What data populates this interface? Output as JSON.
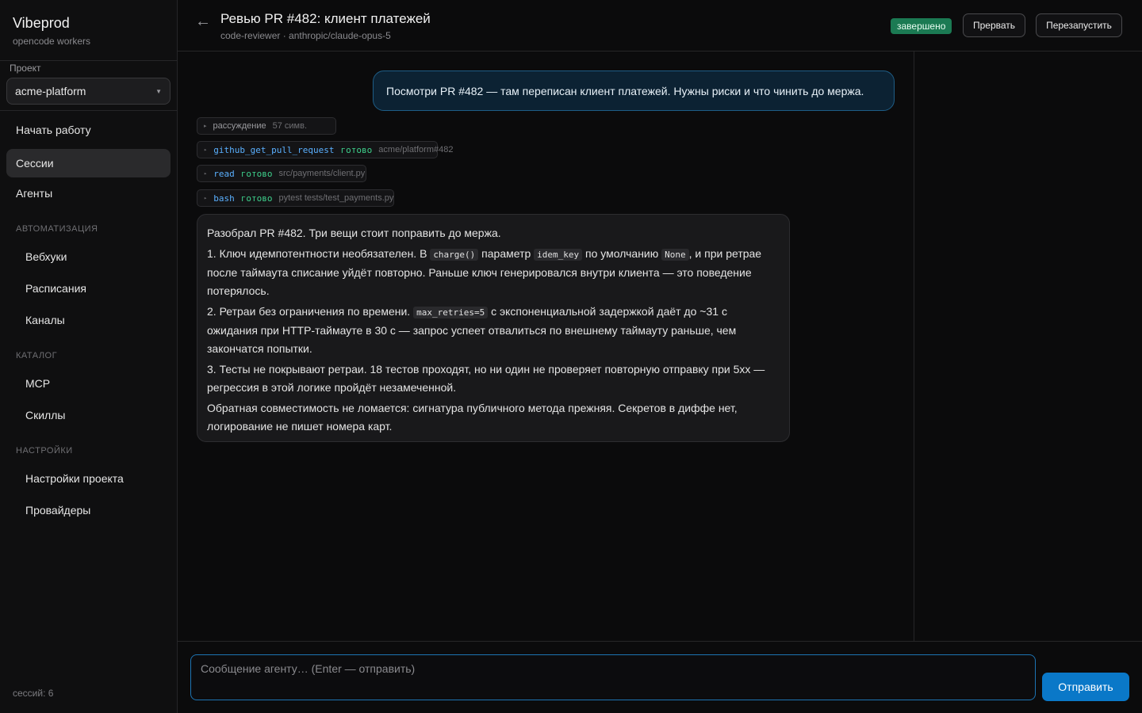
{
  "brand": {
    "title": "Vibeprod",
    "subtitle": "opencode workers"
  },
  "project": {
    "label": "Проект",
    "selected": "acme-platform"
  },
  "nav": {
    "start": "Начать работу",
    "sessions": "Сессии",
    "agents": "Агенты",
    "automation_section": "АВТОМАТИЗАЦИЯ",
    "webhooks": "Вебхуки",
    "schedules": "Расписания",
    "channels": "Каналы",
    "catalog_section": "КАТАЛОГ",
    "mcp": "MCP",
    "skills": "Скиллы",
    "settings_section": "НАСТРОЙКИ",
    "project_settings": "Настройки проекта",
    "providers": "Провайдеры",
    "active": "sessions"
  },
  "sessions_count": "сессий: 6",
  "header": {
    "back_icon": "←",
    "title": "Ревью PR #482: клиент платежей",
    "subtitle": "code-reviewer · anthropic/claude-opus-5",
    "status": "завершено",
    "status_color": "#1b7a53",
    "abort_label": "Прервать",
    "restart_label": "Перезапустить"
  },
  "messages": {
    "user": "Посмотри PR #482 — там переписан клиент платежей. Нужны риски и что чинить до мержа.",
    "thinking": {
      "label": "рассуждение",
      "meta": "57 симв."
    },
    "tools": [
      {
        "name": "github_get_pull_request",
        "status": "готово",
        "arg": "acme/platform#482"
      },
      {
        "name": "read",
        "status": "готово",
        "arg": "src/payments/client.py"
      },
      {
        "name": "bash",
        "status": "готово",
        "arg": "pytest tests/test_payments.py"
      }
    ],
    "answer": {
      "intro": "Разобрал PR #482. Три вещи стоит поправить до мержа.",
      "p1_a": "1. Ключ идемпотентности необязателен. В ",
      "p1_code1": "charge()",
      "p1_b": " параметр ",
      "p1_code2": "idem_key",
      "p1_c": " по умолчанию ",
      "p1_code3": "None",
      "p1_d": ", и при ретрае после таймаута списание уйдёт повторно. Раньше ключ генерировался внутри клиента — это поведение потерялось.",
      "p2_a": "2. Ретраи без ограничения по времени. ",
      "p2_code": "max_retries=5",
      "p2_b": " с экспоненциальной задержкой даёт до ~31 с ожидания при HTTP-таймауте в 30 с — запрос успеет отвалиться по внешнему таймауту раньше, чем закончатся попытки.",
      "p3": "3. Тесты не покрывают ретраи. 18 тестов проходят, но ни один не проверяет повторную отправку при 5xx — регрессия в этой логике пройдёт незамеченной.",
      "outro": "Обратная совместимость не ломается: сигнатура публичного метода прежняя. Секретов в диффе нет, логирование не пишет номера карт."
    }
  },
  "composer": {
    "placeholder": "Сообщение агенту… (Enter — отправить)",
    "send_label": "Отправить"
  },
  "colors": {
    "accent": "#0a78c8",
    "tool_name": "#5ab0ff",
    "tool_status": "#3ed18c"
  }
}
